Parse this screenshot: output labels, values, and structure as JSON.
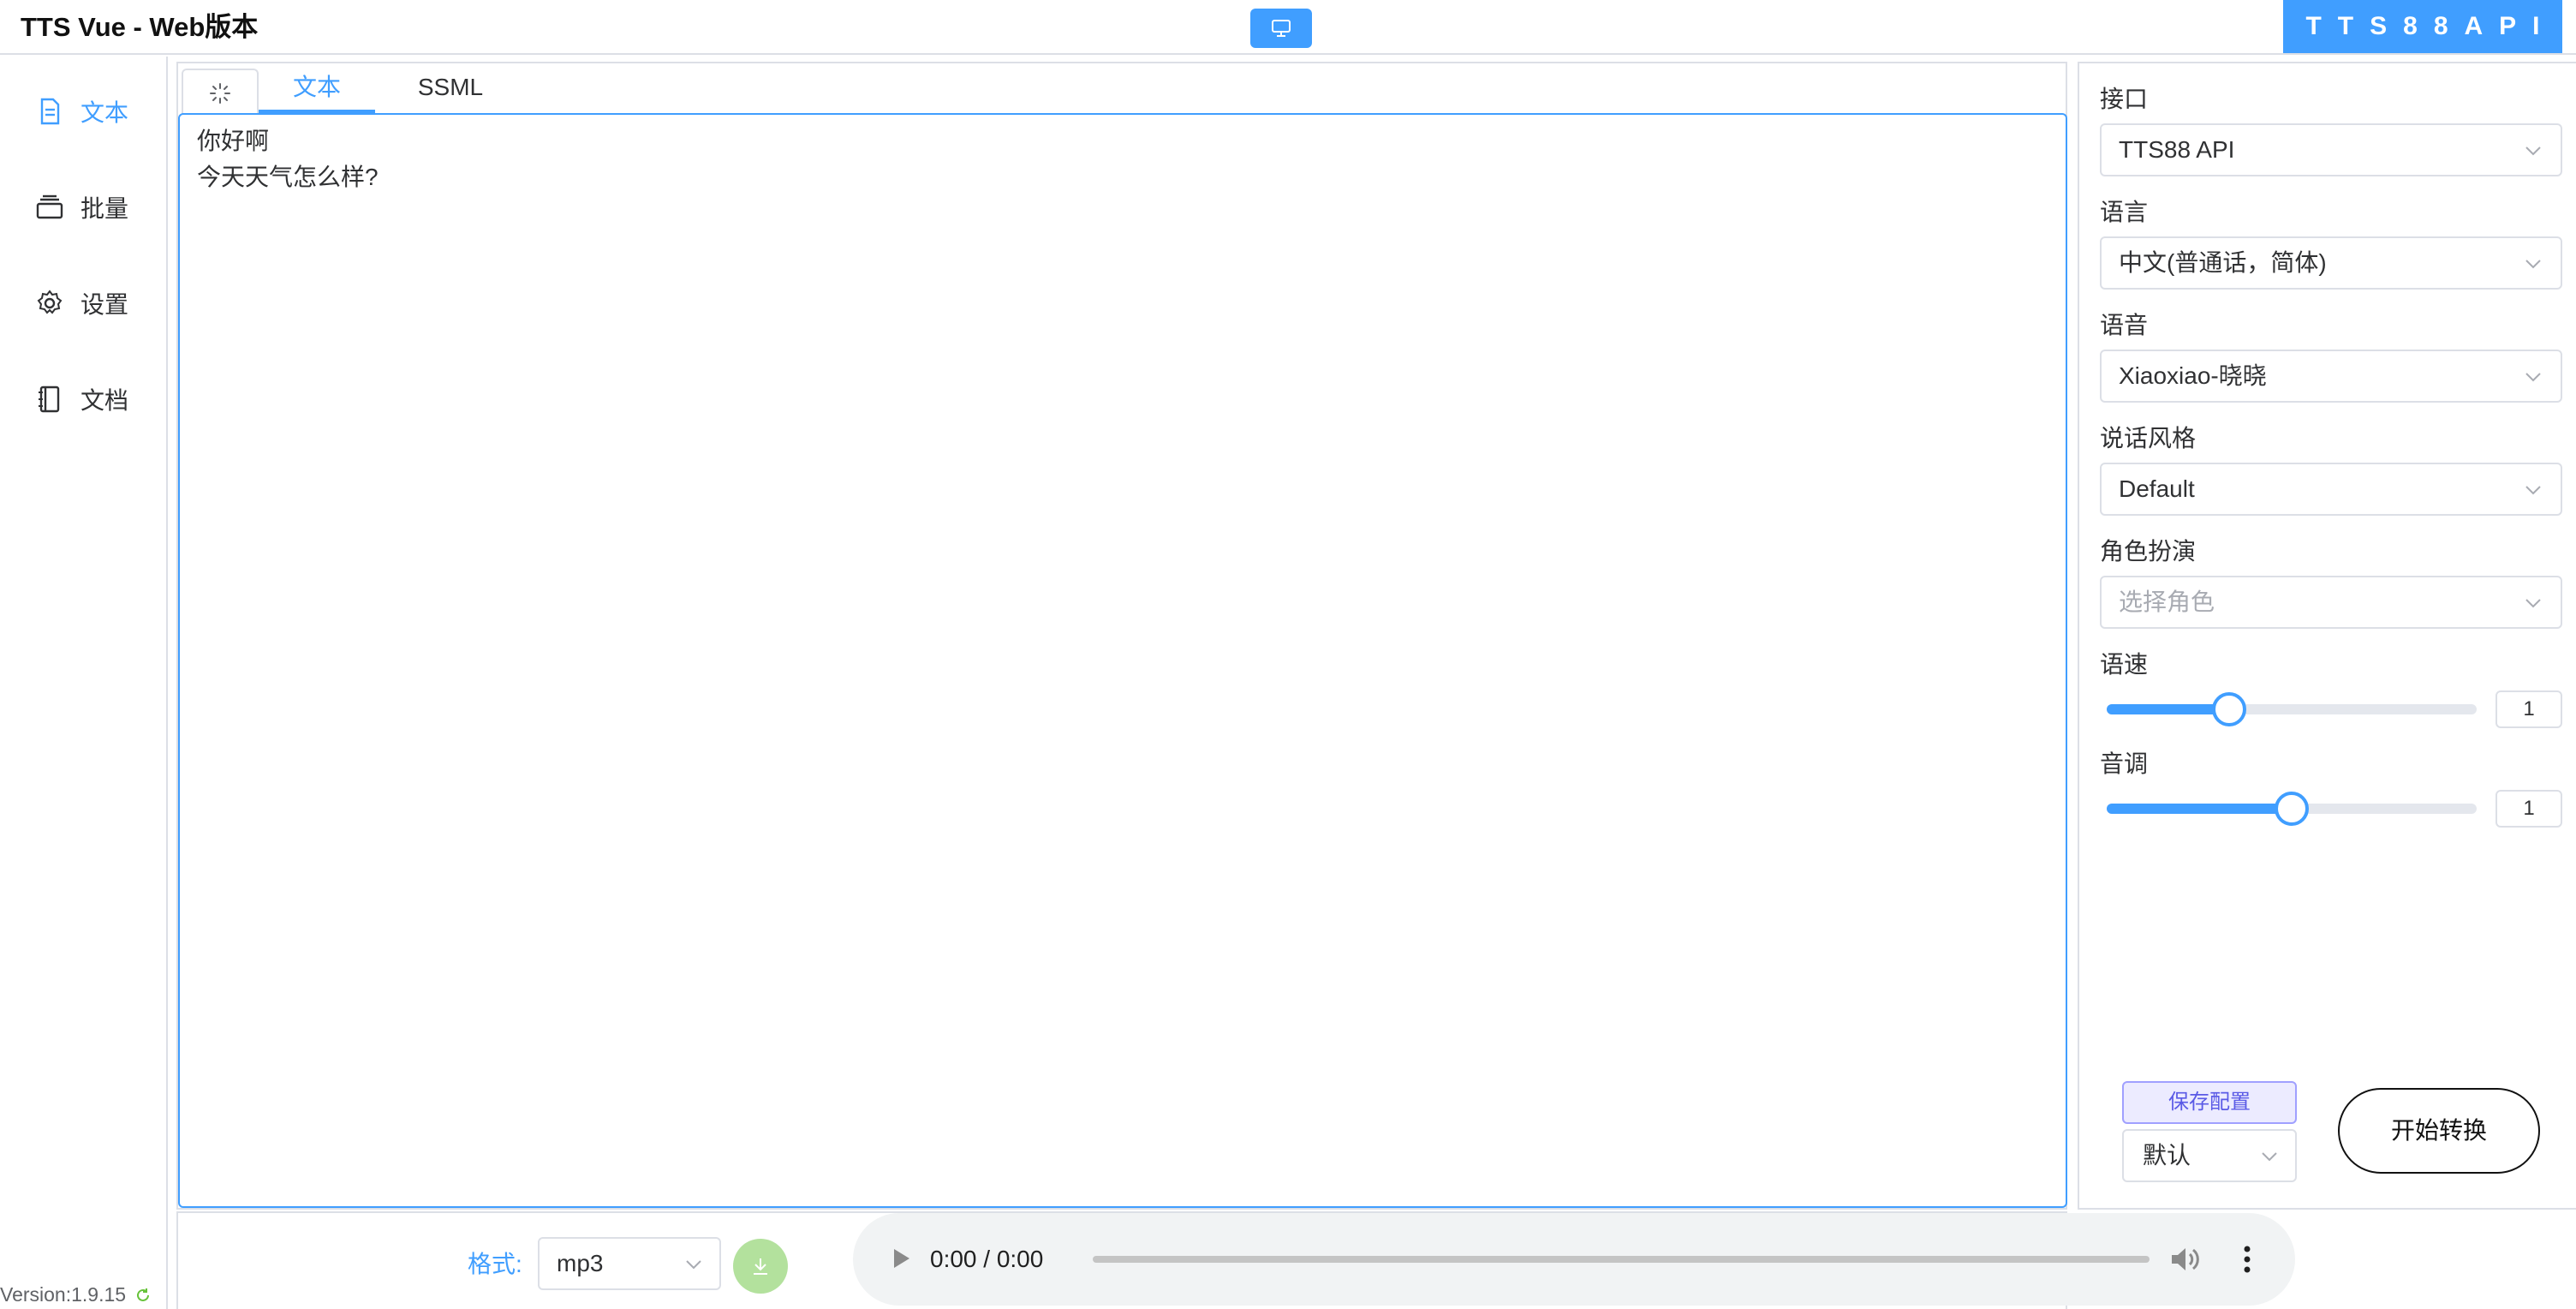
{
  "header": {
    "title": "TTS Vue - Web版本",
    "brand": "TTS88API"
  },
  "sidebar": {
    "items": [
      {
        "label": "文本",
        "icon": "document-icon",
        "active": true
      },
      {
        "label": "批量",
        "icon": "layers-icon",
        "active": false
      },
      {
        "label": "设置",
        "icon": "gear-icon",
        "active": false
      },
      {
        "label": "文档",
        "icon": "notebook-icon",
        "active": false
      }
    ],
    "version": "Version:1.9.15"
  },
  "editor": {
    "tabs": [
      {
        "label": "文本",
        "active": true
      },
      {
        "label": "SSML",
        "active": false
      }
    ],
    "lines": [
      "你好啊",
      "今天天气怎么样?"
    ]
  },
  "bottom": {
    "format_label": "格式:",
    "format_value": "mp3",
    "audio_time": "0:00 / 0:00"
  },
  "settings": {
    "api_label": "接口",
    "api_value": "TTS88 API",
    "language_label": "语言",
    "language_value": "中文(普通话，简体)",
    "voice_label": "语音",
    "voice_value": "Xiaoxiao-晓晓",
    "style_label": "说话风格",
    "style_value": "Default",
    "role_label": "角色扮演",
    "role_placeholder": "选择角色",
    "speed_label": "语速",
    "speed_value": "1",
    "speed_fraction": 0.33,
    "pitch_label": "音调",
    "pitch_value": "1",
    "pitch_fraction": 0.5,
    "save_config": "保存配置",
    "preset_value": "默认",
    "start_button": "开始转换"
  },
  "colors": {
    "accent": "#409eff",
    "download_green": "#b3e19d",
    "save_purple": "#5a5ae6"
  }
}
